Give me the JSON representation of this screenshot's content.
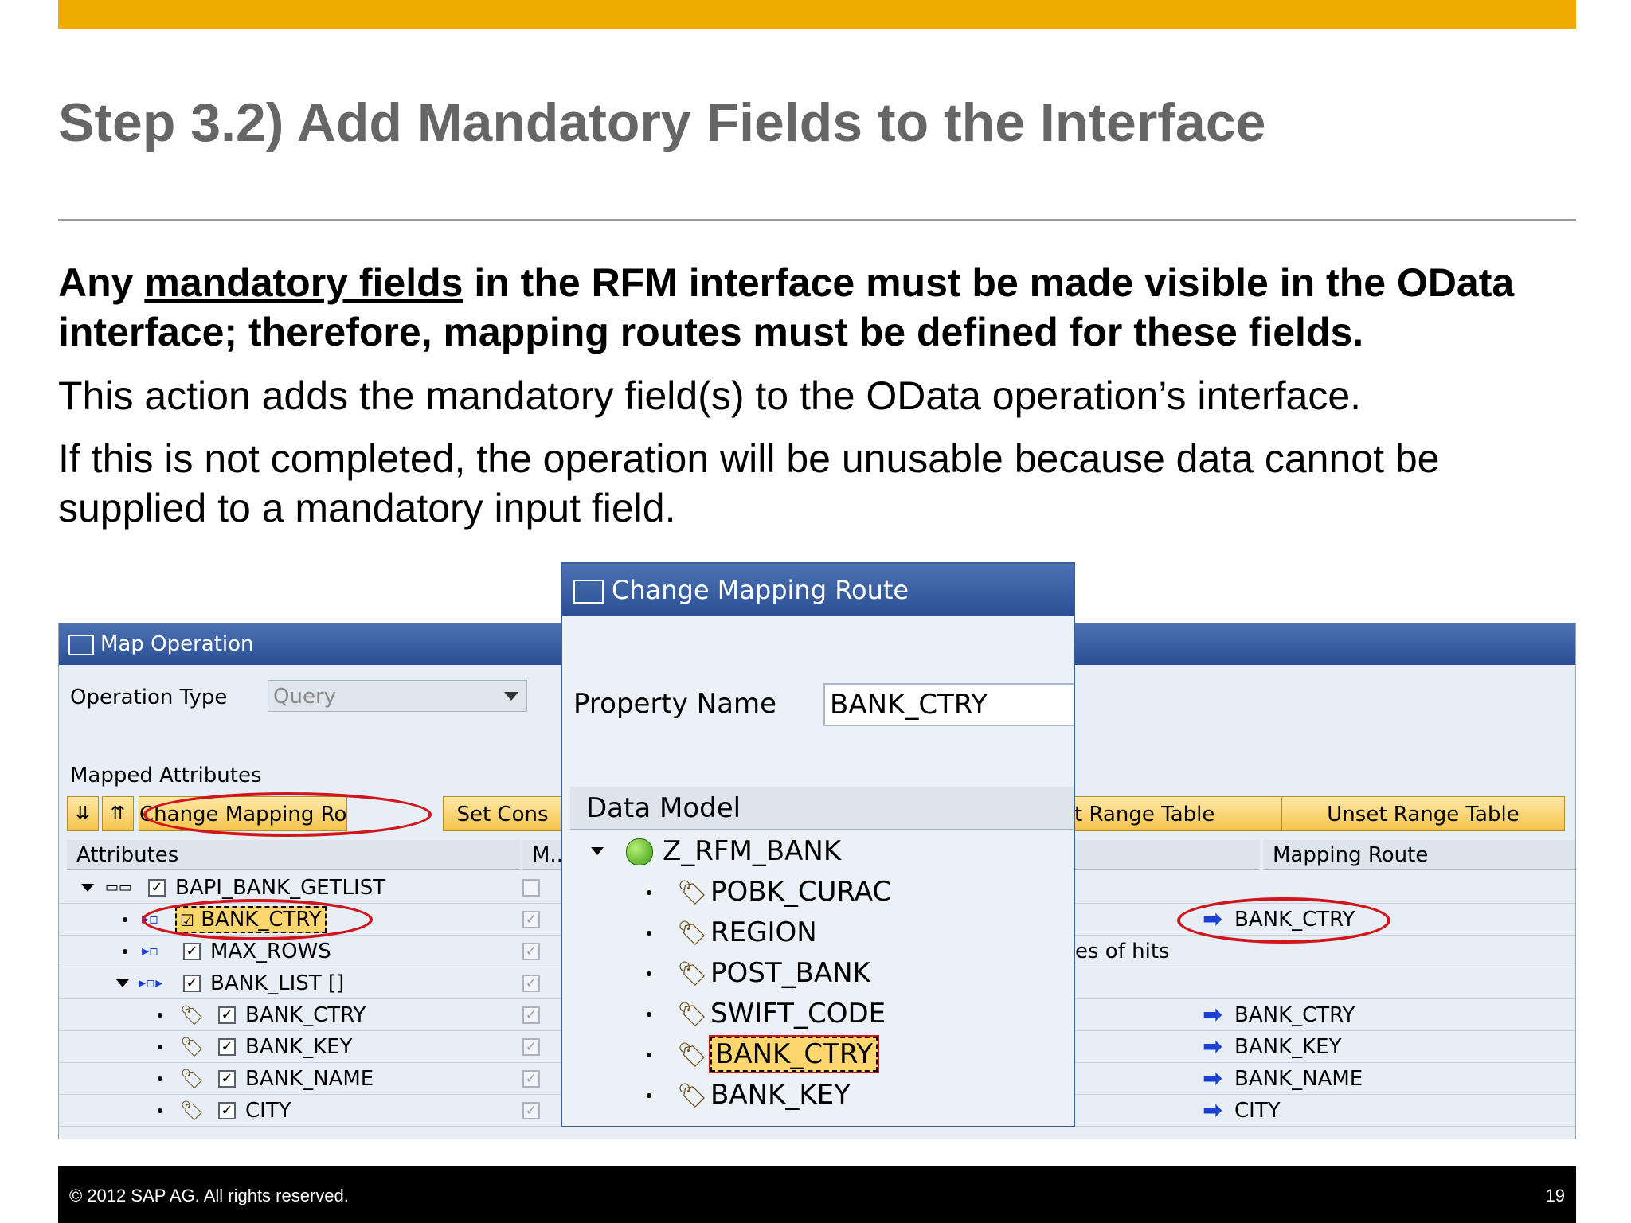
{
  "slide": {
    "title": "Step 3.2) Add Mandatory Fields to the Interface",
    "bold_prefix": "Any ",
    "bold_link": "mandatory fields",
    "bold_rest": " in the RFM interface must be made visible in the OData interface; therefore, mapping routes must be defined for these fields.",
    "para2": "This action adds the mandatory field(s) to the OData operation’s interface.",
    "para3": "If this is not completed, the operation will be unusable because data cannot be supplied to a mandatory input field.",
    "footer_copyright": "© 2012 SAP AG. All rights reserved.",
    "page_number": "19",
    "accent_color": "#f0ab00"
  },
  "map_operation": {
    "title": "Map Operation",
    "operation_type_label": "Operation Type",
    "operation_type_value": "Query",
    "mapped_attributes_label": "Mapped Attributes",
    "buttons": {
      "change_mapping_route": "Change Mapping Route",
      "set_cons": "Set Cons",
      "set_range_table": "t Range Table",
      "unset_range_table": "Unset Range Table"
    },
    "columns": {
      "attributes": "Attributes",
      "mandatory": "M...",
      "mapping_route": "Mapping Route"
    },
    "partial_text": "es of hits",
    "rows": [
      {
        "name": "BAPI_BANK_GETLIST",
        "route": ""
      },
      {
        "name": "BANK_CTRY",
        "route": "BANK_CTRY"
      },
      {
        "name": "MAX_ROWS",
        "route": ""
      },
      {
        "name": "BANK_LIST []",
        "route": ""
      },
      {
        "name": "BANK_CTRY",
        "route": "BANK_CTRY"
      },
      {
        "name": "BANK_KEY",
        "route": "BANK_KEY"
      },
      {
        "name": "BANK_NAME",
        "route": "BANK_NAME"
      },
      {
        "name": "CITY",
        "route": "CITY"
      }
    ]
  },
  "change_mapping_route": {
    "title": "Change Mapping Route",
    "property_name_label": "Property Name",
    "property_name_value": "BANK_CTRY",
    "data_model_label": "Data Model",
    "root": "Z_RFM_BANK",
    "items": [
      "POBK_CURAC",
      "REGION",
      "POST_BANK",
      "SWIFT_CODE",
      "BANK_CTRY",
      "BANK_KEY"
    ]
  }
}
